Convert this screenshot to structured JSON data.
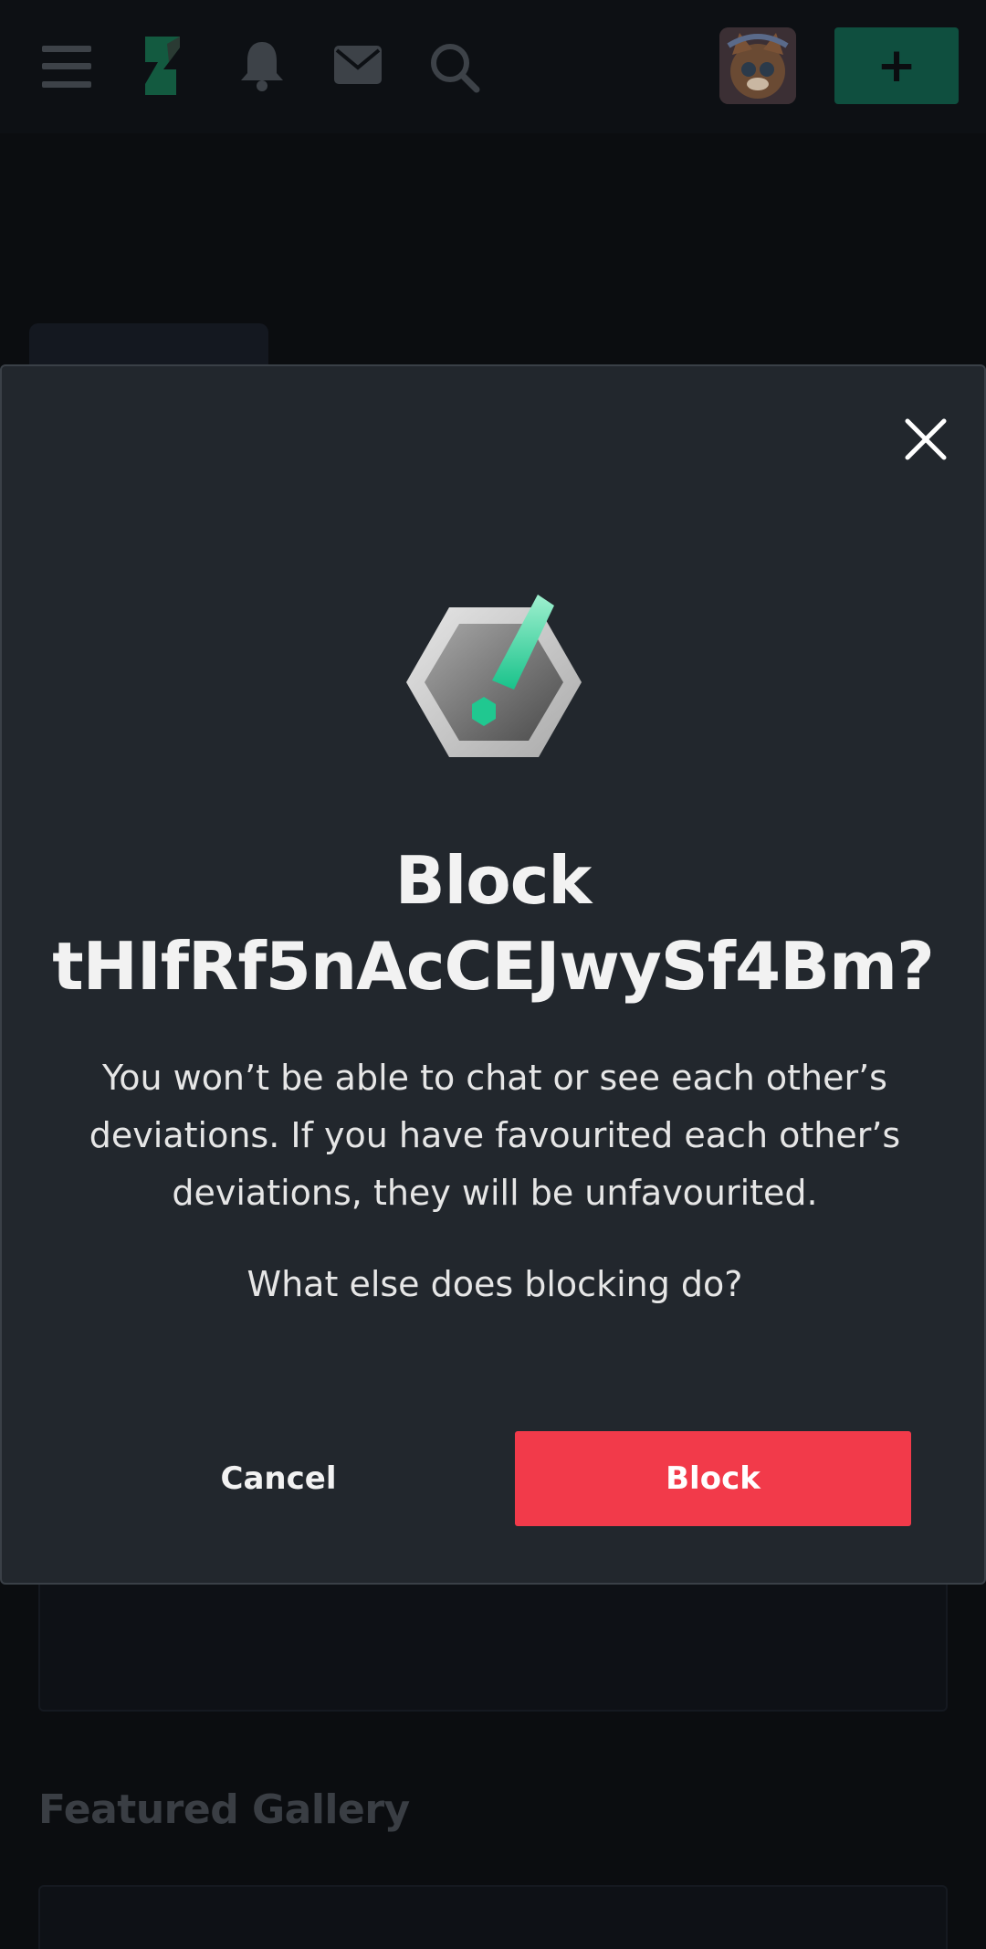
{
  "header": {
    "icons": [
      "menu-icon",
      "deviantart-logo",
      "bell-icon",
      "mail-icon",
      "search-icon",
      "avatar",
      "plus-icon"
    ],
    "create_label": "+"
  },
  "background": {
    "section_heading": "Featured Gallery"
  },
  "modal": {
    "title": "Block tHIfRf5nAcCEJwySf4Bm?",
    "description": "You won’t be able to chat or see each other’s deviations. If you have favourited each other’s deviations, they will be unfavourited.",
    "help_link": "What else does blocking do?",
    "cancel_label": "Cancel",
    "block_label": "Block",
    "icon": "warning-hexagon-icon",
    "close_icon": "close-icon"
  },
  "colors": {
    "accent_green": "#18c28a",
    "danger_red": "#f23a4a",
    "modal_bg": "#22272d",
    "page_bg": "#0b0d10"
  }
}
